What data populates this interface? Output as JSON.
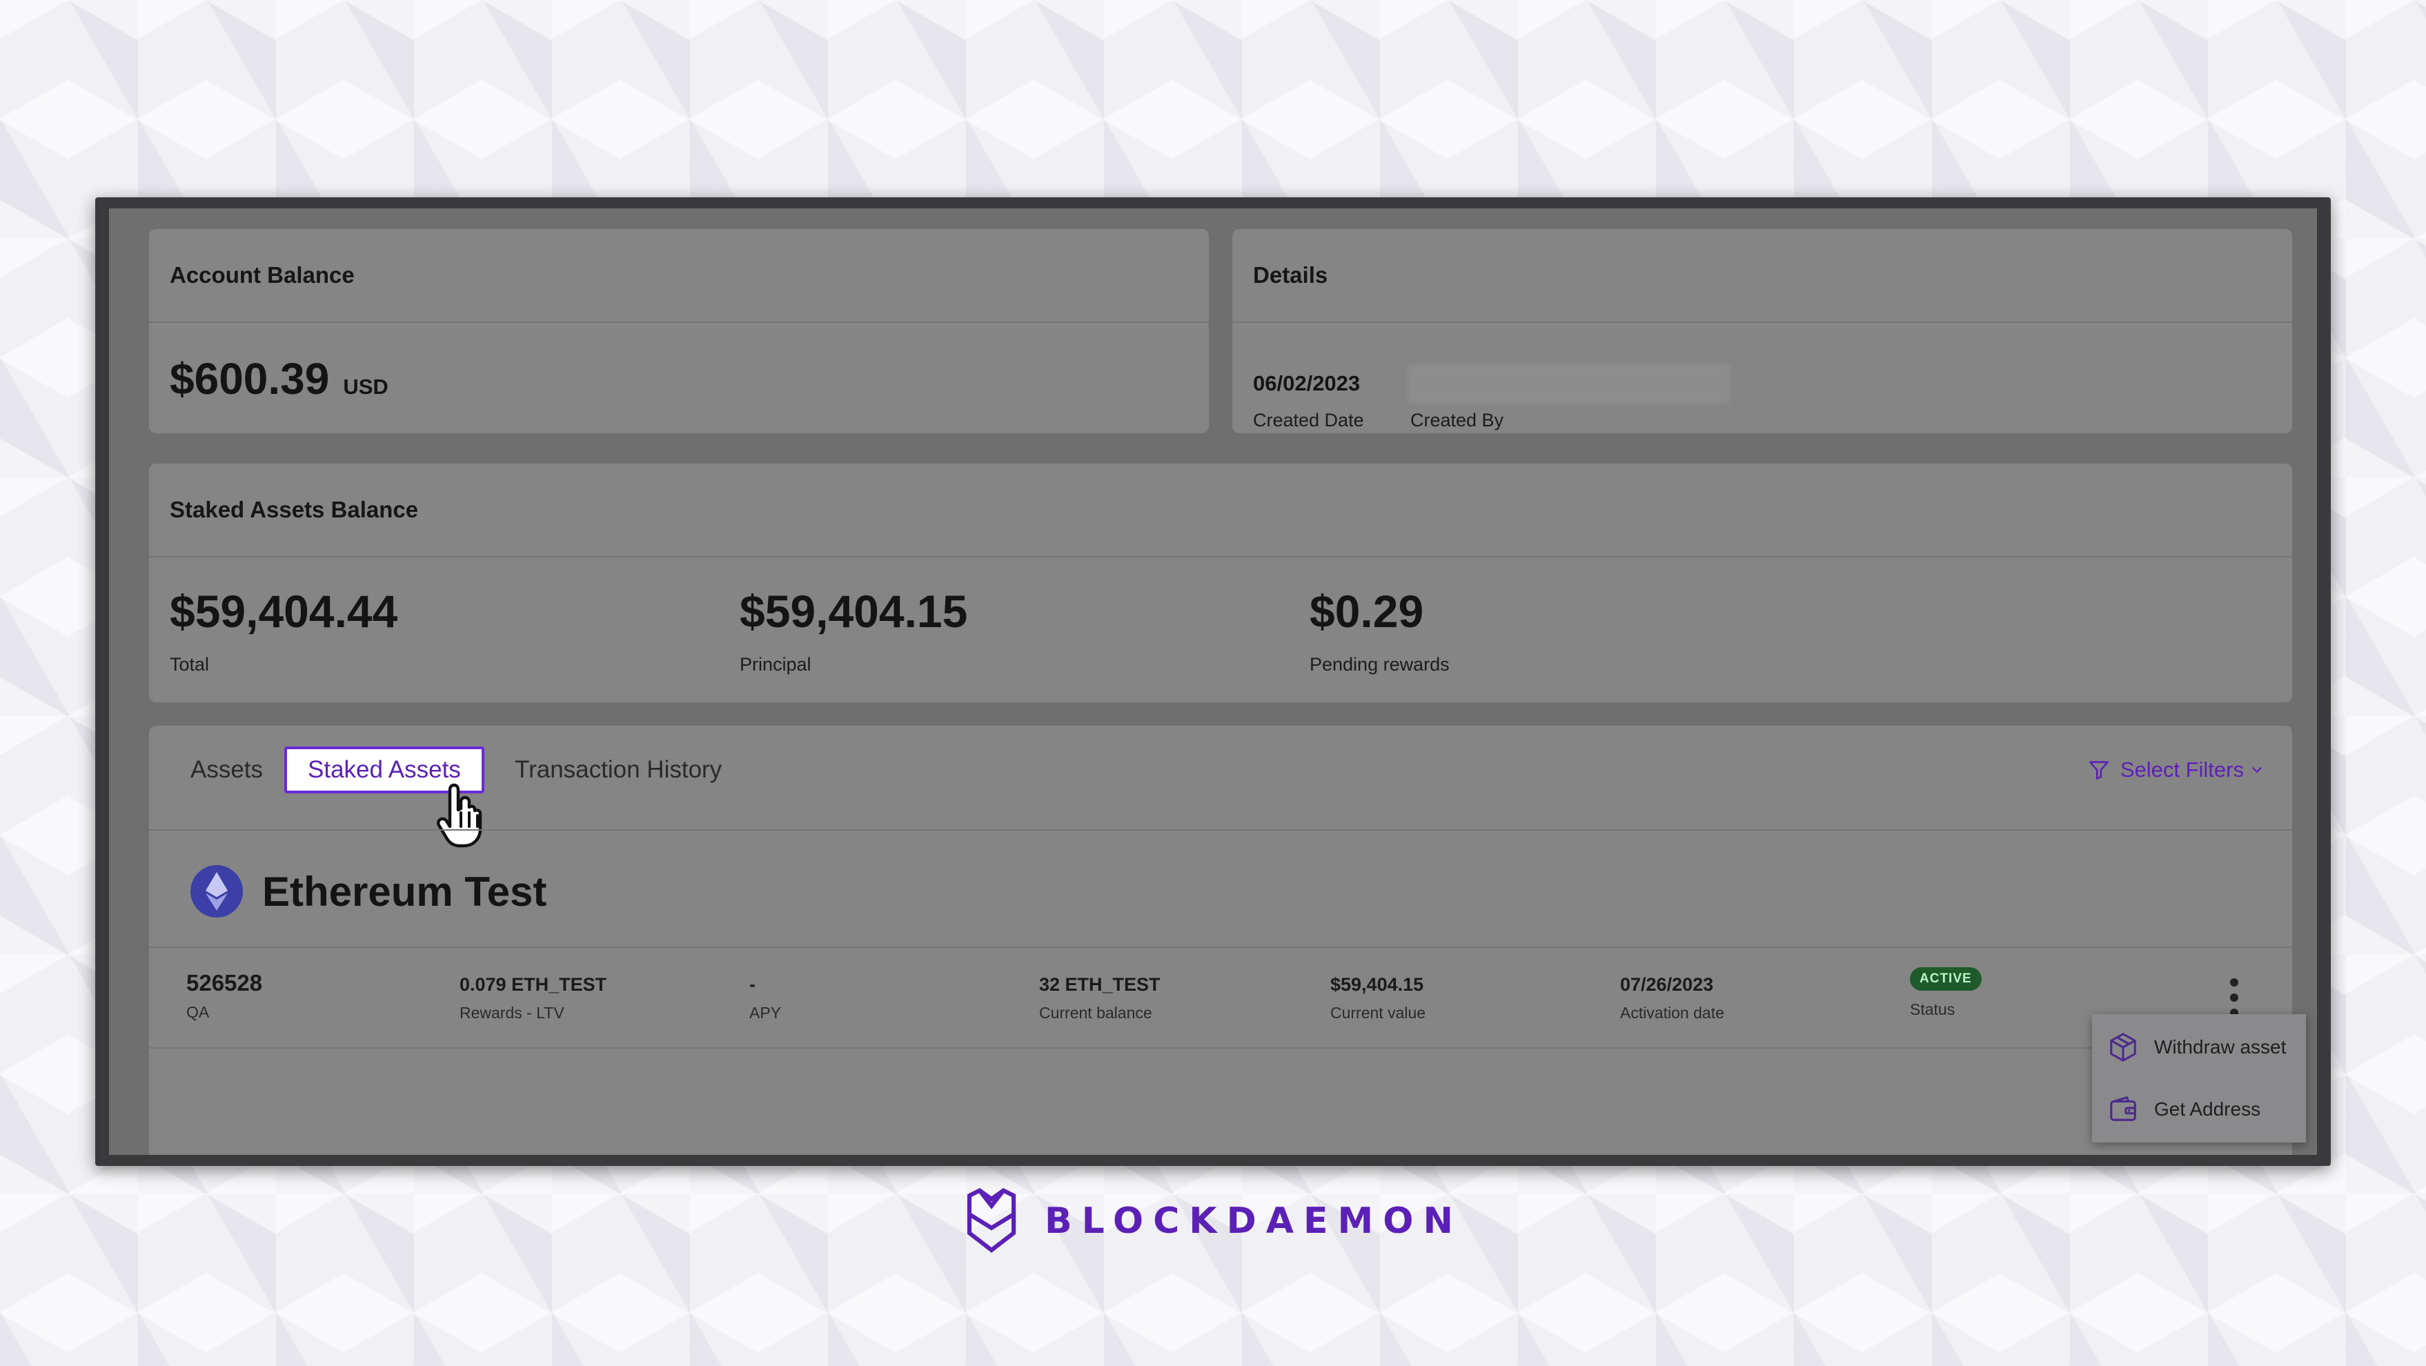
{
  "account_balance": {
    "title": "Account Balance",
    "amount": "$600.39",
    "currency": "USD"
  },
  "details": {
    "title": "Details",
    "created_date_value": "06/02/2023",
    "created_date_label": "Created Date",
    "created_by_label": "Created By"
  },
  "staked": {
    "title": "Staked Assets Balance",
    "total_value": "$59,404.44",
    "total_label": "Total",
    "principal_value": "$59,404.15",
    "principal_label": "Principal",
    "pending_value": "$0.29",
    "pending_label": "Pending rewards"
  },
  "tabs": [
    {
      "label": "Assets"
    },
    {
      "label": "Staked Assets"
    },
    {
      "label": "Transaction History"
    }
  ],
  "filters": {
    "label": "Select Filters"
  },
  "asset_group": {
    "name": "Ethereum Test"
  },
  "row": {
    "id": "526528",
    "id_sub": "QA",
    "rewards_value": "0.079 ETH_TEST",
    "rewards_label": "Rewards - LTV",
    "apy_value": "-",
    "apy_label": "APY",
    "balance_value": "32 ETH_TEST",
    "balance_label": "Current balance",
    "current_value": "$59,404.15",
    "current_value_label": "Current value",
    "activation_value": "07/26/2023",
    "activation_label": "Activation date",
    "status_badge": "ACTIVE",
    "status_label": "Status"
  },
  "menu": {
    "withdraw": "Withdraw asset",
    "get_address": "Get Address"
  },
  "brand": {
    "name": "BLOCKDAEMON",
    "accent": "#5b21b6"
  }
}
